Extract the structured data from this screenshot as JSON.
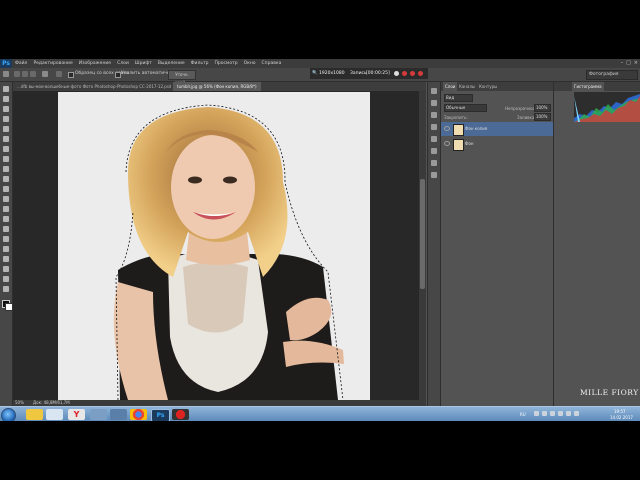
{
  "app": {
    "logo": "Ps"
  },
  "menu": [
    "Файл",
    "Редактирование",
    "Изображение",
    "Слои",
    "Шрифт",
    "Выделение",
    "Фильтр",
    "Просмотр",
    "Окно",
    "Справка"
  ],
  "window_buttons": [
    "–",
    "□",
    "×"
  ],
  "options_bar": {
    "cb1_label": "Образец со всех слоев",
    "cb2_label": "Усилить автоматически",
    "refine_edge_button": "Уточн. край..."
  },
  "zoom_field": {
    "zoom": "1920x1080",
    "record_label": "Запись",
    "time": "[00:00:25]"
  },
  "workspace": "Фотография",
  "doc_tabs": [
    "...dfb вы-мои-волшебные-фото Фото Photoshop-Photoshop CC-2017-12.psd @ 66,7% (RGB/8)",
    "tumblr.jpg @ 56% (Фон копия, RGB/8*)"
  ],
  "status": {
    "zoom": "50%",
    "doc": "Док: 48,8M/61,7M"
  },
  "layers_panel": {
    "tabs": [
      "Слои",
      "Каналы",
      "Контуры"
    ],
    "filter": "Вид",
    "blend_mode": "Обычные",
    "opacity_label": "Непрозрачность:",
    "opacity": "100%",
    "lock_label": "Закрепить:",
    "fill_label": "Заливка:",
    "fill": "100%",
    "layers": [
      {
        "name": "Фон копия",
        "selected": true
      },
      {
        "name": "Фон",
        "selected": false
      }
    ]
  },
  "right_panel": {
    "tab": "Гистограмма"
  },
  "tray": {
    "lang": "RU",
    "time": "19:57",
    "date": "14.02.2017"
  },
  "watermark": "MILLE FIORY"
}
